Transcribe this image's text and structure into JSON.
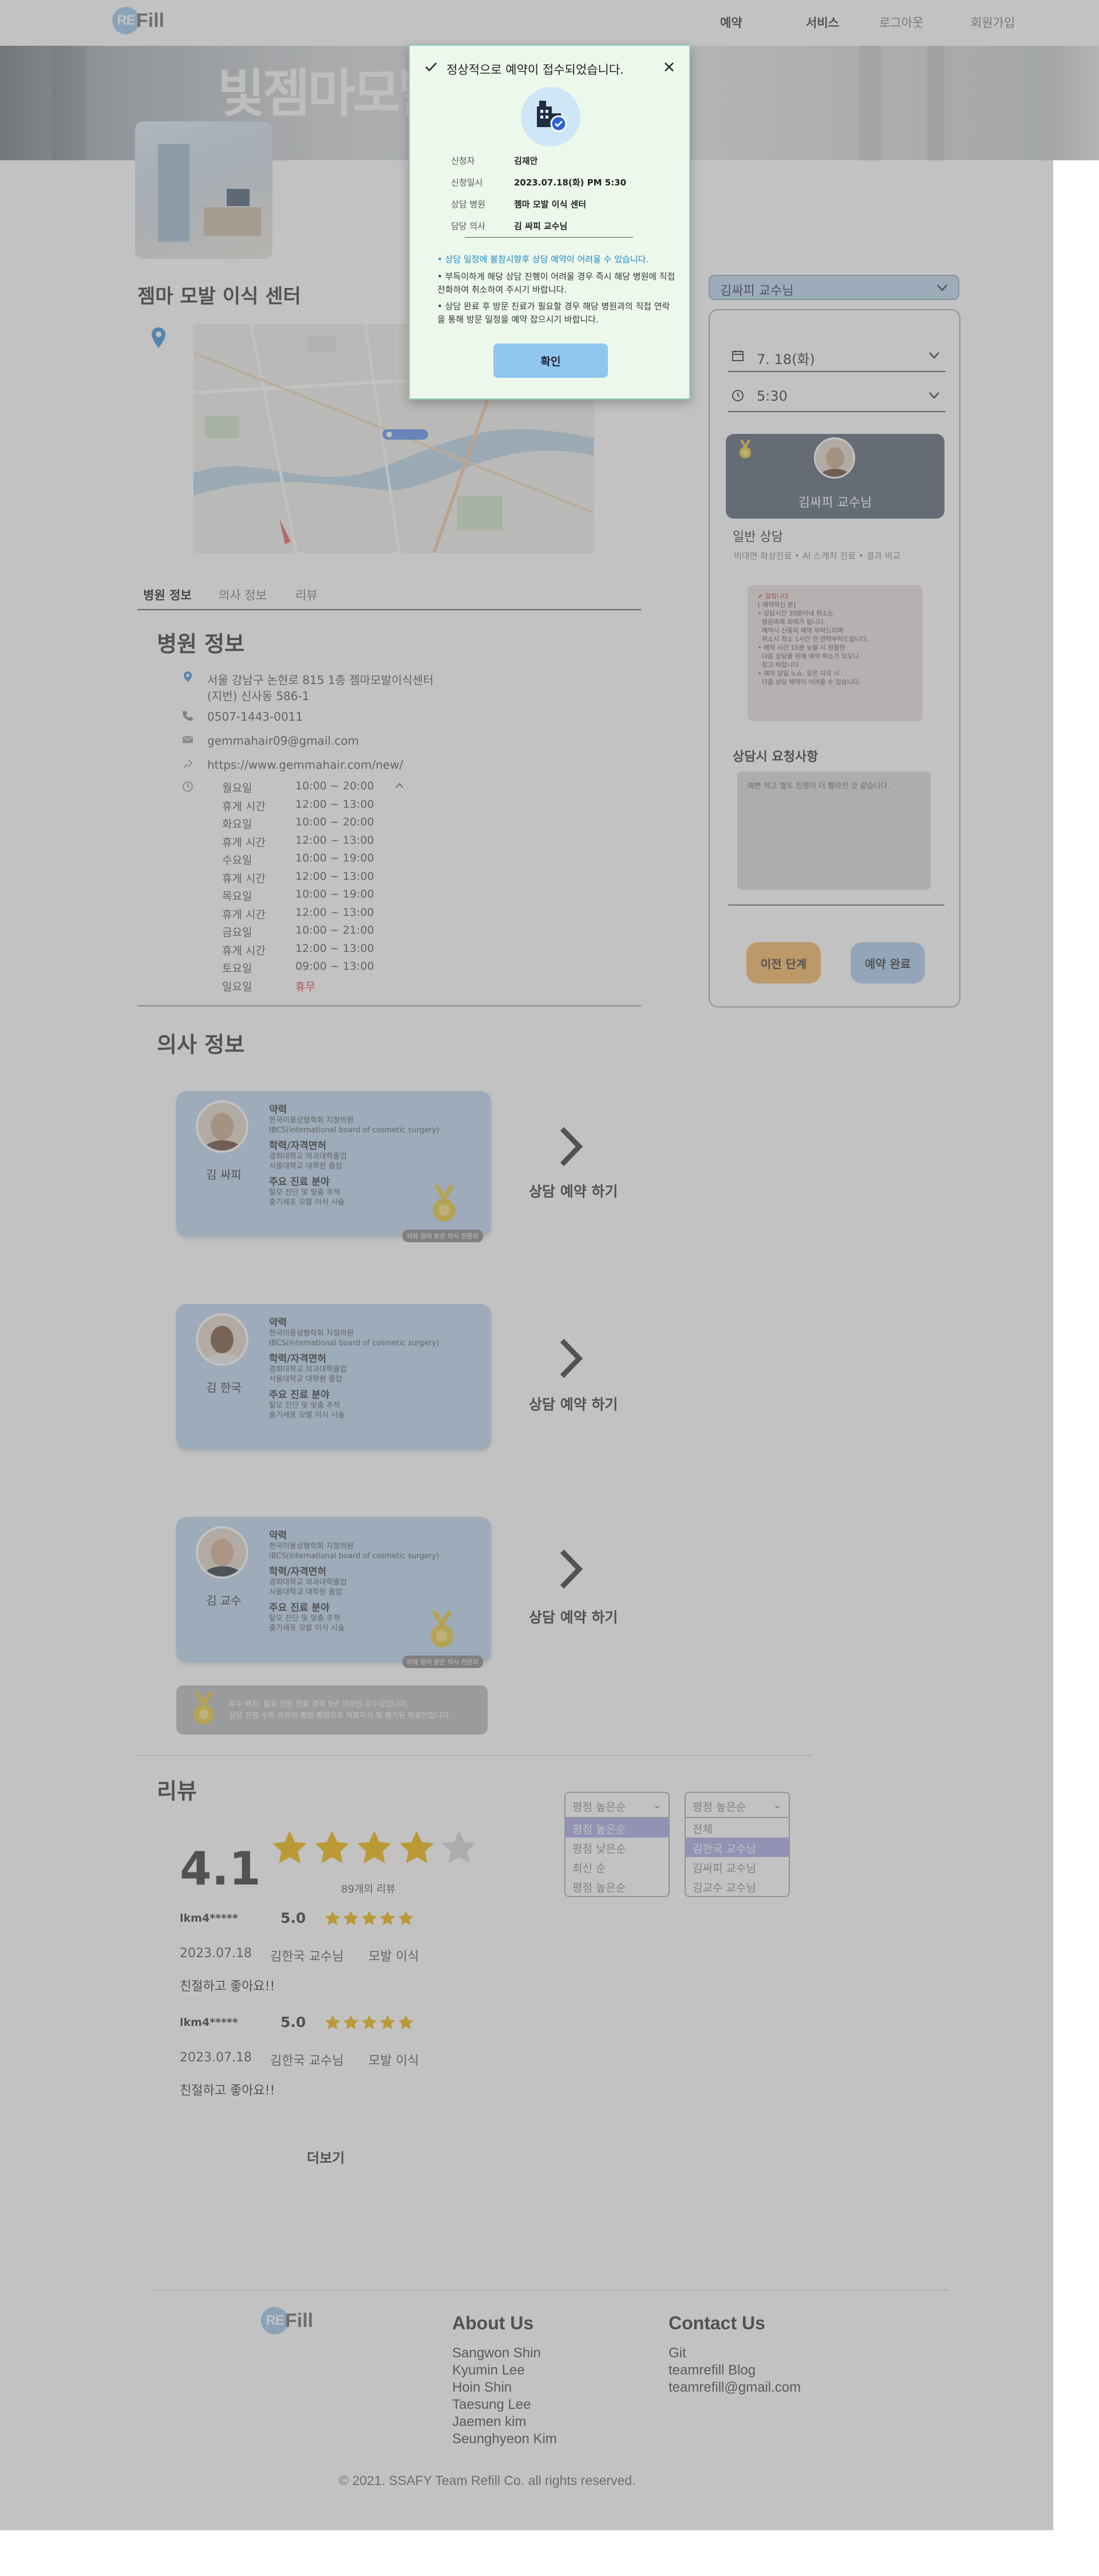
{
  "header": {
    "logo_circle": "RE",
    "logo_rest": "Fill",
    "nav": [
      "예약",
      "서비스",
      "로그아웃",
      "회원가입"
    ]
  },
  "hero": {
    "sign_text": "빛젬마모발이식"
  },
  "clinic": {
    "name": "젬마 모발 이식 센터",
    "tabs": [
      "병원 정보",
      "의사 정보",
      "리뷰"
    ]
  },
  "hospital_info": {
    "heading": "병원 정보",
    "address_line1": "서울 강남구 논현로 815 1층 젬마모발이식센터",
    "address_line2": "(지번) 신사동 586-1",
    "phone": "0507-1443-0011",
    "email": "gemmahair09@gmail.com",
    "website": "https://www.gemmahair.com/new/",
    "hours": [
      {
        "day": "월요일",
        "time": "10:00 ~ 20:00",
        "red": false
      },
      {
        "day": "휴게 시간",
        "time": "12:00 ~ 13:00",
        "red": false
      },
      {
        "day": "화요일",
        "time": "10:00 ~ 20:00",
        "red": false
      },
      {
        "day": "휴게 시간",
        "time": "12:00 ~ 13:00",
        "red": false
      },
      {
        "day": "수요일",
        "time": "10:00 ~ 19:00",
        "red": false
      },
      {
        "day": "휴게 시간",
        "time": "12:00 ~ 13:00",
        "red": false
      },
      {
        "day": "목요일",
        "time": "10:00 ~ 19:00",
        "red": false
      },
      {
        "day": "휴게 시간",
        "time": "12:00 ~ 13:00",
        "red": false
      },
      {
        "day": "금요일",
        "time": "10:00 ~ 21:00",
        "red": false
      },
      {
        "day": "휴게 시간",
        "time": "12:00 ~ 13:00",
        "red": false
      },
      {
        "day": "토요일",
        "time": "09:00 ~ 13:00",
        "red": false
      },
      {
        "day": "일요일",
        "time": "휴무",
        "red": true
      }
    ]
  },
  "doctors": {
    "heading": "의사 정보",
    "book_label": "상담 예약 하기",
    "cards": [
      {
        "name": "김 싸피",
        "h1": "약력",
        "l1": "한국미용성형학회 지정의원",
        "l2": "IBCS(international board of cosmetic surgery)",
        "h2": "학력/자격면허",
        "l3": "경희대학교 의과대학졸업",
        "l4": "서울대학교 대학원 졸업",
        "h3": "주요 진료 분야",
        "l5": "탈모 진단 및 맞춤 추적",
        "l6": "줄기세포 모발 이식 시술",
        "tag": "리뷰 많이 받은 의사 전문의",
        "medal": true
      },
      {
        "name": "김 한국",
        "h1": "약력",
        "l1": "한국미용성형학회 지정의원",
        "l2": "IBCS(international board of cosmetic surgery)",
        "h2": "학력/자격면허",
        "l3": "경희대학교 의과대학졸업",
        "l4": "서울대학교 대학원 졸업",
        "h3": "주요 진료 분야",
        "l5": "탈모 진단 및 맞춤 추적",
        "l6": "줄기세포 모발 이식 시술",
        "tag": "",
        "medal": false
      },
      {
        "name": "김 교수",
        "h1": "약력",
        "l1": "한국미용성형학회 지정의원",
        "l2": "IBCS(international board of cosmetic surgery)",
        "h2": "학력/자격면허",
        "l3": "경희대학교 의과대학졸업",
        "l4": "서울대학교 대학원 졸업",
        "h3": "주요 진료 분야",
        "l5": "탈모 진단 및 맞춤 추적",
        "l6": "줄기세포 모발 이식 시술",
        "tag": "리뷰 많이 받은 의사 전문의",
        "medal": true
      }
    ],
    "notice_line1": "우수 배지: 탈모 전문 진료 경력 5년 이상인 교수임입니다.",
    "notice_line2": "상담 진행 수와 리뷰의 평점 평점으로 의료지식 및 평가된 의료인입니다."
  },
  "reviews": {
    "heading": "리뷰",
    "average": "4.1",
    "average_value": 4.1,
    "count_label": "89개의 리뷰",
    "items": [
      {
        "user": "lkm4*****",
        "score": "5.0",
        "date": "2023.07.18",
        "doctor": "김한국 교수님",
        "category": "모발 이식",
        "text": "친절하고 좋아요!!"
      },
      {
        "user": "lkm4*****",
        "score": "5.0",
        "date": "2023.07.18",
        "doctor": "김한국 교수님",
        "category": "모발 이식",
        "text": "친절하고 좋아요!!"
      }
    ],
    "more_label": "더보기",
    "sort_dropdown": {
      "current": "평점 높은순",
      "options": [
        "평점 높은순",
        "평점 낮은순",
        "최신 순",
        "평점 높은순"
      ],
      "selected_index": 0
    },
    "doctor_dropdown": {
      "current": "평점 높은순",
      "options": [
        "전체",
        "김한국 교수님",
        "김싸피 교수님",
        "김교수 교수님"
      ],
      "selected_index": 1
    }
  },
  "booking": {
    "doctor_select": "김싸피 교수님",
    "date": "7. 18(화)",
    "time": "5:30",
    "doctor_label": "김싸피 교수님",
    "consult_type": "일반 상담",
    "consult_desc": "비대면 화상진료 • AI 스캐치 진료 • 결과 비교",
    "memo_title": "✔ 알립니다",
    "memo_lines": [
      "[ 예약하신 분]",
      "• 상담시간 30분이내 취소는",
      "  병원측에 죄에가 됩니다.",
      "  예약시 신중히 예약 부탁드리며",
      "  취소시 최소 1시간 전 연락부탁드립니다.",
      "• 예약 시간 15분 늦을 시 원활한",
      "  다음 상담을 위해 예약 취소가 되오니",
      "  참고 바랍니다.",
      "• 예약 당일 노쇼, 잦은 지각 시",
      "  다음 상담 예약이 어려울 수 있습니다."
    ],
    "request_label": "상담시 요청사항",
    "request_placeholder": "예쁜 적고 별도 진행이 더 빨라진 것 같습니다.",
    "prev_btn": "이전 단계",
    "done_btn": "예약 완료"
  },
  "modal": {
    "title": "정상적으로 예약이 접수되었습니다.",
    "fields": [
      {
        "k": "신청자",
        "v": "김재안"
      },
      {
        "k": "신청일시",
        "v": "2023.07.18(화) PM 5:30"
      },
      {
        "k": "상담 병원",
        "v": "젬마 모발 이식 센터"
      },
      {
        "k": "담당 의사",
        "v": "김 싸피 교수님"
      }
    ],
    "bullet1": "상담 일정에 불참시향후 상담 예약이 어려울 수 있습니다.",
    "bullet2": "부득이하게 해당 상담 진행이 어려울 경우 즉시 해당 병원에 직접 전화하여 취소하여 주시기 바랍니다.",
    "bullet3": "상담 완료 후 방문 진료가 필요할 경우 해당 병원과의 직접 연락을 통해 방문 일정을 예약 잡으시기 바랍니다.",
    "ok": "확인"
  },
  "footer": {
    "logo_circle": "RE",
    "logo_rest": "Fill",
    "about_title": "About Us",
    "about": [
      "Sangwon Shin",
      "Kyumin Lee",
      "Hoin Shin",
      "Taesung Lee",
      "Jaemen kim",
      "Seunghyeon Kim"
    ],
    "contact_title": "Contact Us",
    "contact": [
      "Git",
      "teamrefill Blog",
      "teamrefill@gmail.com"
    ],
    "copyright": "© 2021. SSAFY Team Refill Co. all rights reserved."
  },
  "colors": {
    "accent": "#8fc7f0",
    "card": "#bcd6f1",
    "star": "#f0b400",
    "overlay": "#787878"
  }
}
